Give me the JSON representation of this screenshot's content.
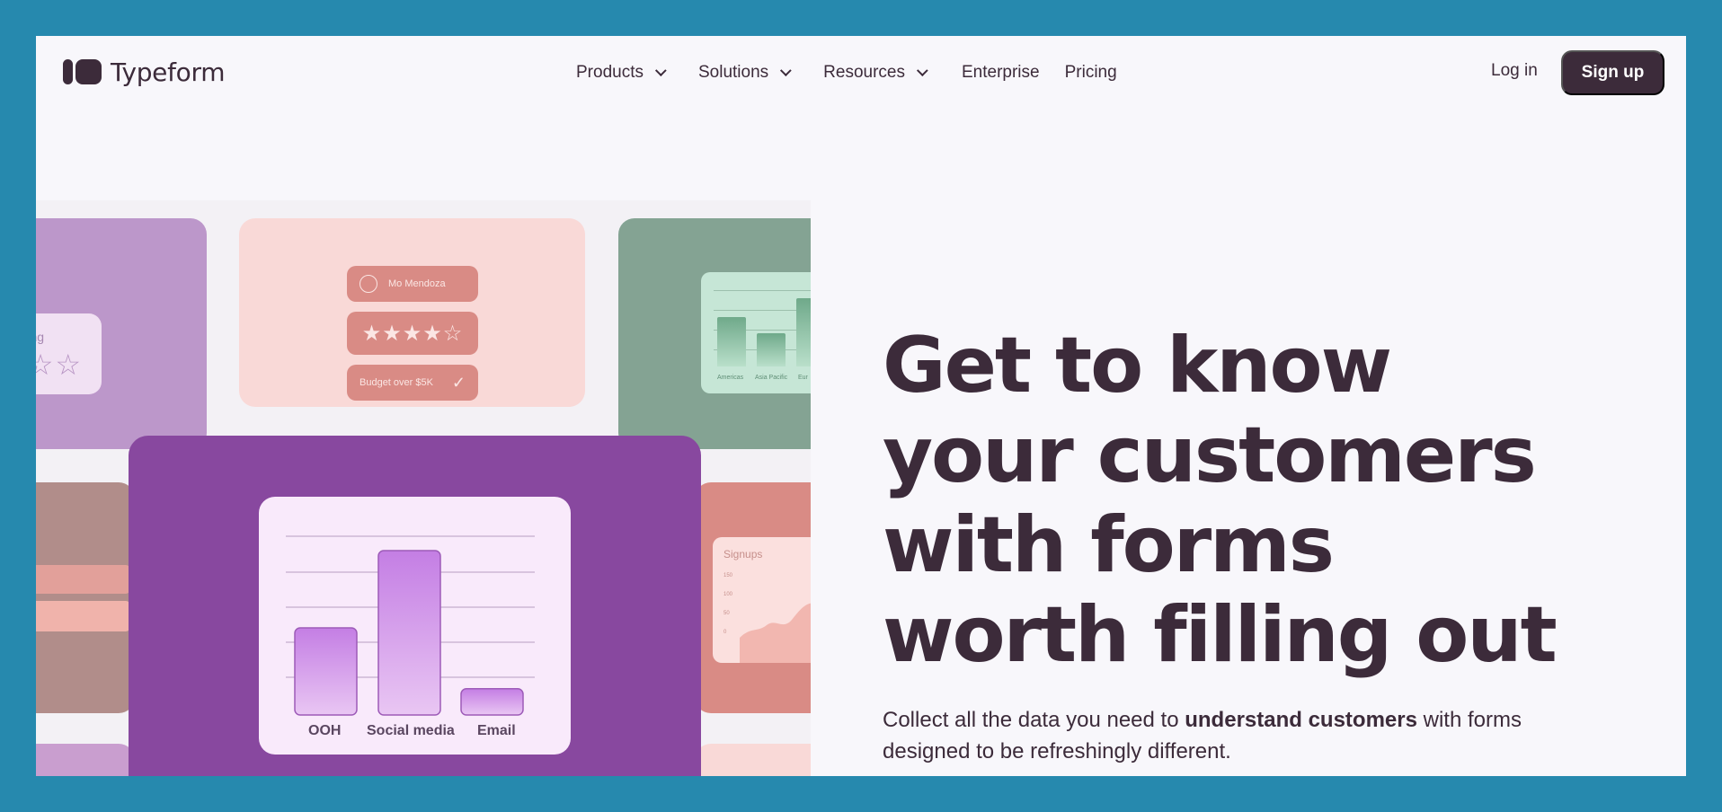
{
  "brand": {
    "name": "Typeform",
    "color": "#3c2b3a",
    "background": "#2689ae"
  },
  "nav": {
    "items": [
      {
        "label": "Products",
        "icon": "chevron-down-icon"
      },
      {
        "label": "Solutions",
        "icon": "chevron-down-icon"
      },
      {
        "label": "Resources",
        "icon": "chevron-down-icon"
      }
    ],
    "links": [
      "Enterprise",
      "Pricing"
    ],
    "login": "Log in",
    "signup": "Sign up"
  },
  "hero": {
    "headline": [
      "Get to know",
      "your customers",
      "with forms",
      "worth filling out"
    ],
    "sub_pre": "Collect all the data you need to ",
    "sub_bold": "understand customers",
    "sub_post": " with forms designed to be refreshingly different."
  },
  "collage": {
    "rating_label": "rating",
    "rating_stars": "☆☆☆",
    "contact_name": "Mo Mendoza",
    "stars": "★★★★☆",
    "budget_label": "Budget over $5K",
    "region_chart": {
      "labels": [
        "Americas",
        "Asia Pacific",
        "Eur"
      ],
      "values": [
        55,
        37,
        76
      ]
    },
    "signups_title": "Signups",
    "signups_ticks": [
      "150",
      "100",
      "50",
      "0"
    ],
    "channel_chart": {
      "categories": [
        "OOH",
        "Social media",
        "Email"
      ],
      "values": [
        53,
        100,
        16
      ]
    }
  }
}
